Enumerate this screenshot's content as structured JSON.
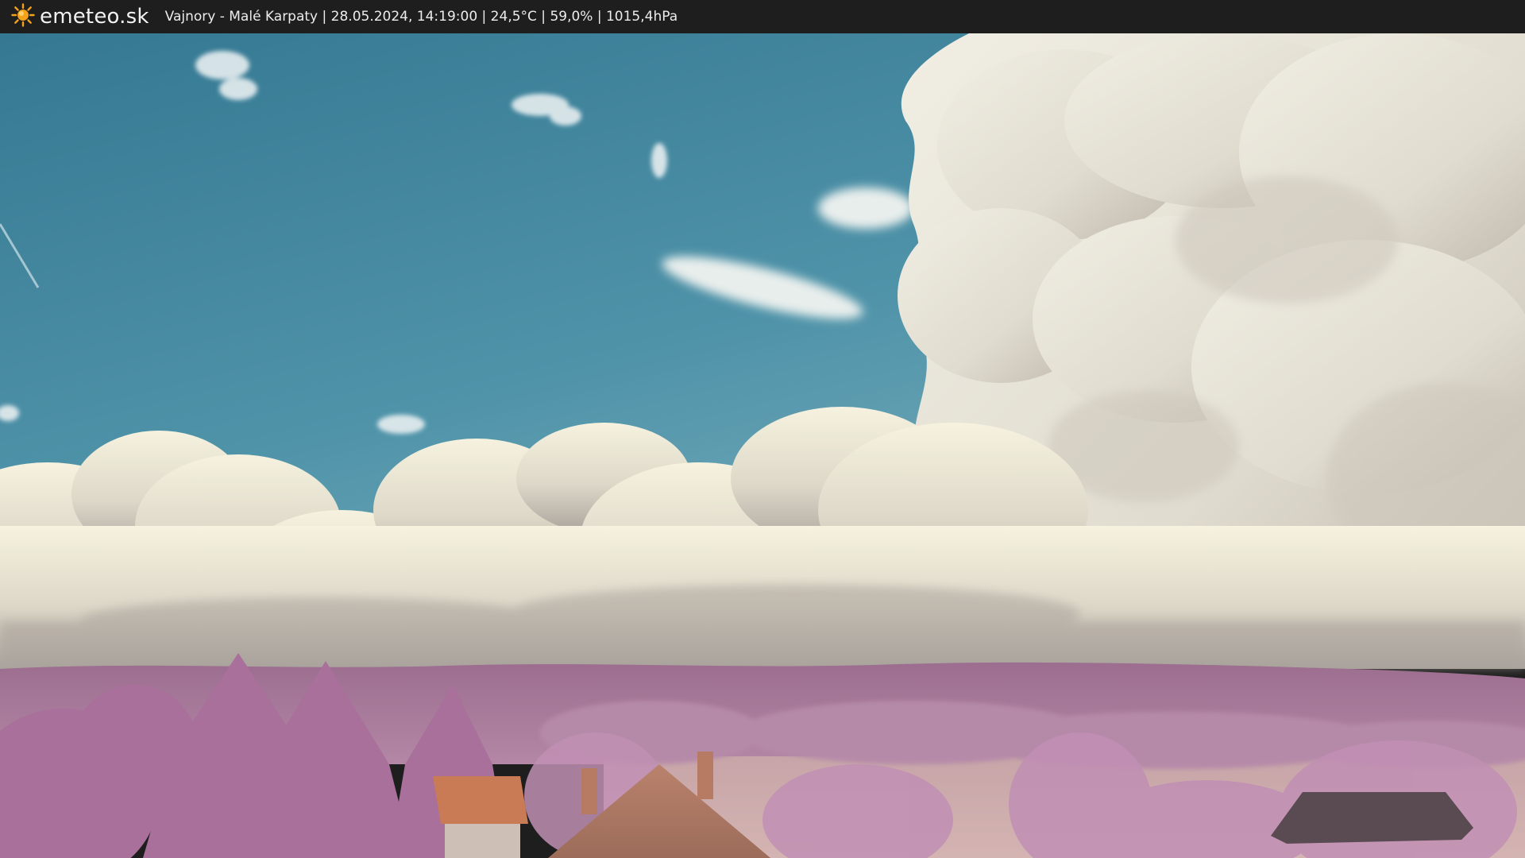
{
  "header": {
    "brand": "emeteo.sk",
    "brand_icon": "sun-icon",
    "caption": "Vajnory - Malé Karpaty | 28.05.2024, 14:19:00 | 24,5°C | 59,0% | 1015,4hPa"
  },
  "colors": {
    "bar_background": "#1e1e1e",
    "sun": "#f5a21b",
    "sky": "#4c8fa6",
    "foliage": "#b27aa3",
    "roof": "#c97b56"
  }
}
